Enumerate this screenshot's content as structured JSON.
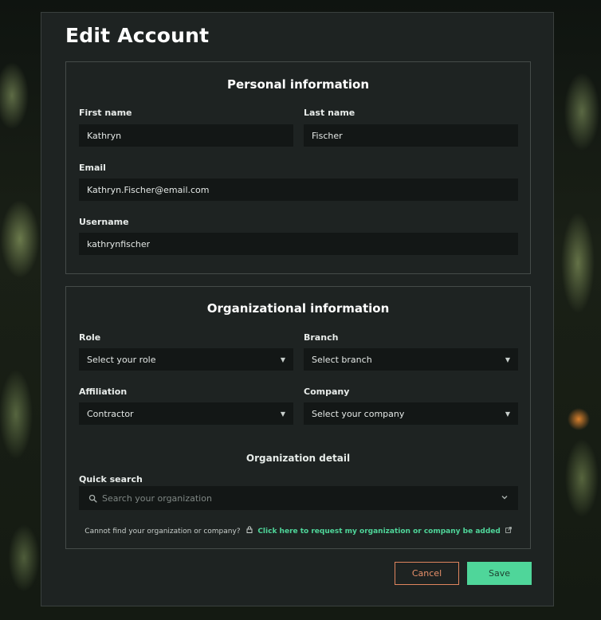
{
  "page": {
    "title": "Edit Account"
  },
  "personal": {
    "title": "Personal information",
    "first_name": {
      "label": "First name",
      "value": "Kathryn"
    },
    "last_name": {
      "label": "Last name",
      "value": "Fischer"
    },
    "email": {
      "label": "Email",
      "value": "Kathryn.Fischer@email.com"
    },
    "username": {
      "label": "Username",
      "value": "kathrynfischer"
    }
  },
  "organizational": {
    "title": "Organizational information",
    "role": {
      "label": "Role",
      "value": "Select your role"
    },
    "branch": {
      "label": "Branch",
      "value": "Select branch"
    },
    "affiliation": {
      "label": "Affiliation",
      "value": "Contractor"
    },
    "company": {
      "label": "Company",
      "value": "Select your company"
    },
    "detail_title": "Organization detail",
    "quick_search": {
      "label": "Quick search",
      "placeholder": "Search your organization",
      "value": ""
    },
    "help_text": "Cannot find your organization or company?",
    "help_link": "Click here to request my organization or company be added"
  },
  "actions": {
    "cancel_label": "Cancel",
    "save_label": "Save"
  },
  "colors": {
    "accent": "#4fd69a",
    "cancel": "#e0855e",
    "panel": "#1e2322",
    "field": "#131716"
  },
  "icons": {
    "dropdown": "caret-down-icon",
    "search": "search-icon",
    "chevron": "chevron-down-icon",
    "lock": "lock-icon",
    "external": "external-link-icon"
  }
}
